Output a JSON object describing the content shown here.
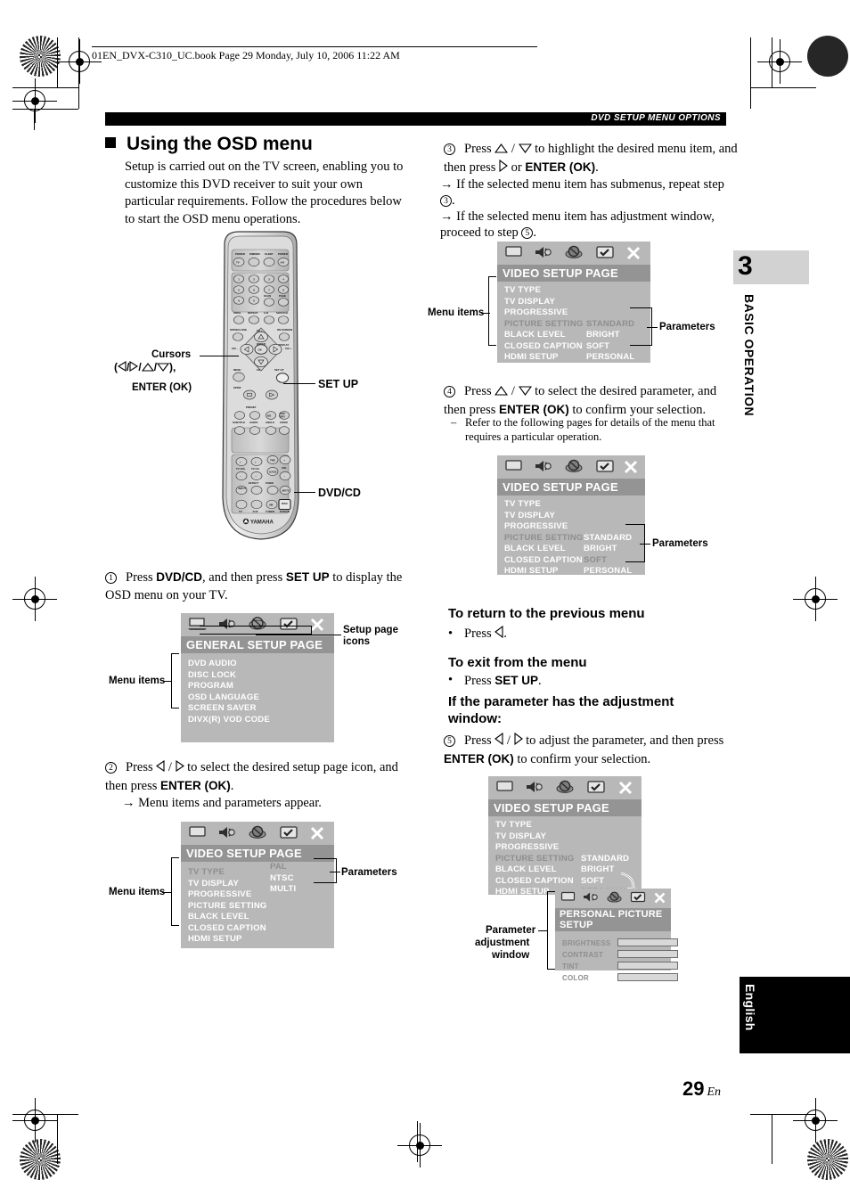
{
  "print_header": {
    "text": "01EN_DVX-C310_UC.book  Page 29  Monday, July 10, 2006  11:22 AM"
  },
  "running_head": {
    "text": "DVD SETUP MENU OPTIONS"
  },
  "page": {
    "number": "29",
    "lang_suffix": "En",
    "chapter_number": "3",
    "chapter_label": "BASIC OPERATION",
    "language_tab": "English"
  },
  "left_column": {
    "heading": "Using the OSD menu",
    "intro": "Setup is carried out on the TV screen, enabling you to customize this DVD receiver to suit your own particular requirements. Follow the procedures below to start the OSD menu operations.",
    "remote_callouts": {
      "cursors_label": "Cursors",
      "cursors_sub_open": "(",
      "cursors_sub_close": "),",
      "enter_ok": "ENTER (OK)",
      "setup": "SET UP",
      "dvdcd": "DVD/CD",
      "brand": "YAMAHA"
    },
    "step1": {
      "num": "1",
      "text_a": "Press ",
      "bold_a": "DVD/CD",
      "text_b": ", and then press ",
      "bold_b": "SET UP",
      "text_c": " to display the OSD menu on your TV."
    },
    "step2": {
      "num": "2",
      "text_a": "Press ",
      "text_b": " to select the desired setup page icon, and then press ",
      "bold_b": "ENTER (OK)",
      "text_c": ".",
      "arrow_line": "→ Menu items and parameters appear."
    },
    "callout_setup_icons_line1": "Setup page",
    "callout_setup_icons_line2": "icons",
    "callout_menu_items": "Menu items",
    "callout_parameters": "Parameters"
  },
  "right_column": {
    "step3": {
      "num": "3",
      "text_a": "Press ",
      "text_b": " to highlight the desired menu item, and then press ",
      "text_c": " or ",
      "bold_c": "ENTER (OK)",
      "text_d": ".",
      "arrow1": "→ If the selected menu item has submenus, repeat step",
      "arrow1_num": "3",
      "arrow1_end": ".",
      "arrow2": "→ If the selected menu item has adjustment window, proceed to step",
      "arrow2_num": "5",
      "arrow2_end": "."
    },
    "step4": {
      "num": "4",
      "text_a": "Press ",
      "text_b": " to select the desired parameter, and then press ",
      "bold_b": "ENTER (OK)",
      "text_c": " to confirm your selection.",
      "dash_note": "Refer to the following pages for details of the menu that requires a particular operation."
    },
    "heading_return": "To return to the previous menu",
    "bullet_return_pre": "Press",
    "bullet_return_post": ".",
    "heading_exit": "To exit from the menu",
    "bullet_exit_pre": "Press ",
    "bullet_exit_bold": "SET UP",
    "bullet_exit_post": ".",
    "heading_adjust_l1": "If the parameter has the adjustment",
    "heading_adjust_l2": "window:",
    "step5": {
      "num": "5",
      "text_a": "Press ",
      "text_b": " to adjust the parameter, and then press ",
      "bold_b": "ENTER (OK)",
      "text_c": " to confirm your selection."
    },
    "callout_menu_items": "Menu items",
    "callout_parameters": "Parameters",
    "callout_adjust_l1": "Parameter",
    "callout_adjust_l2": "adjustment",
    "callout_adjust_l3": "window"
  },
  "osd_icons": [
    "tv-icon",
    "audio-icon",
    "disc-icon",
    "preference-icon",
    "exit-icon"
  ],
  "osd_screens": {
    "general": {
      "title": "GENERAL SETUP PAGE",
      "items": [
        "DVD AUDIO",
        "DISC LOCK",
        "PROGRAM",
        "OSD LANGUAGE",
        "SCREEN SAVER",
        "DIVX(R) VOD CODE"
      ],
      "highlighted_index": -1,
      "params": []
    },
    "video_page_icons": {
      "title": "VIDEO SETUP PAGE",
      "items": [
        "TV TYPE",
        "TV DISPLAY",
        "PROGRESSIVE",
        "PICTURE SETTING",
        "BLACK LEVEL",
        "CLOSED CAPTION",
        "HDMI SETUP"
      ],
      "highlighted_index": 0,
      "params": [
        "PAL",
        "NTSC",
        "MULTI"
      ],
      "param_highlighted_index": 0
    },
    "video_menu_items": {
      "title": "VIDEO SETUP PAGE",
      "items": [
        "TV TYPE",
        "TV DISPLAY",
        "PROGRESSIVE",
        "PICTURE SETTING",
        "BLACK LEVEL",
        "CLOSED CAPTION",
        "HDMI SETUP"
      ],
      "highlighted_index": 3,
      "params": [
        "STANDARD",
        "BRIGHT",
        "SOFT",
        "PERSONAL"
      ],
      "param_highlighted_index": 0
    },
    "video_parameters": {
      "title": "VIDEO SETUP PAGE",
      "items": [
        "TV TYPE",
        "TV DISPLAY",
        "PROGRESSIVE",
        "PICTURE SETTING",
        "BLACK LEVEL",
        "CLOSED CAPTION",
        "HDMI SETUP"
      ],
      "highlighted_index": 3,
      "params": [
        "STANDARD",
        "BRIGHT",
        "SOFT",
        "PERSONAL"
      ],
      "param_highlighted_index": 2
    },
    "video_personal": {
      "title": "VIDEO SETUP PAGE",
      "items": [
        "TV TYPE",
        "TV DISPLAY",
        "PROGRESSIVE",
        "PICTURE SETTING",
        "BLACK LEVEL",
        "CLOSED CAPTION",
        "HDMI SETUP"
      ],
      "highlighted_index": 3,
      "params": [
        "STANDARD",
        "BRIGHT",
        "SOFT",
        "PERSONAL"
      ],
      "param_highlighted_index": 3
    },
    "personal_picture": {
      "title": "PERSONAL PICTURE SETUP",
      "bars": [
        {
          "label": "BRIGHTNESS",
          "value": "0",
          "fill_pct": 50,
          "style": "white"
        },
        {
          "label": "CONTRAST",
          "value": "0",
          "fill_pct": 50,
          "style": "dark"
        },
        {
          "label": "TINT",
          "value": "0",
          "fill_pct": 50,
          "style": "dark"
        },
        {
          "label": "COLOR",
          "value": "0",
          "fill_pct": 50,
          "style": "dark"
        }
      ]
    }
  },
  "remote_buttons": {
    "top_row": [
      "POWER",
      "DIMMER",
      "SLEEP",
      "POWER"
    ],
    "top_row_inner": [
      "TV",
      "",
      "",
      "A/V"
    ],
    "numbers": [
      "1",
      "2",
      "3",
      "4",
      "5",
      "6",
      "7",
      "8",
      "9",
      "0"
    ],
    "scan_page": [
      "SCAN",
      "PAGE"
    ],
    "fourth_row": [
      "PROG",
      "REPEAT",
      "A-B",
      "SHUFFLE"
    ],
    "display_row": [
      "OPEN/CLOSE",
      "ON SCREEN",
      "DISPLAY"
    ],
    "nav": [
      "CH +",
      "CH -",
      "VOL -",
      "VOL +",
      "ENTER",
      "OK"
    ],
    "menu": "MENU",
    "setup": "SET UP",
    "spdif": "SPDIF",
    "preset": "PRESET",
    "media_row": [
      "SUBTITLE",
      "AUDIO",
      "ANGLE",
      "ZOOM"
    ],
    "bottom": [
      "TV VOL",
      "TV CH",
      "TRE",
      "VOL",
      "BASS",
      "INPUT",
      "EFFECT",
      "SUBW",
      "MUTE",
      "TV",
      "AUX",
      "XM TUNER",
      "DISC DVD/CD"
    ]
  },
  "colors": {
    "osd_bg": "#b8b8b8",
    "osd_title_bg": "#949494",
    "osd_text": "#ffffff",
    "osd_dim_text": "#8e8e8e",
    "chapter_box": "#d2d2d2",
    "bar_rule": "#000000"
  }
}
